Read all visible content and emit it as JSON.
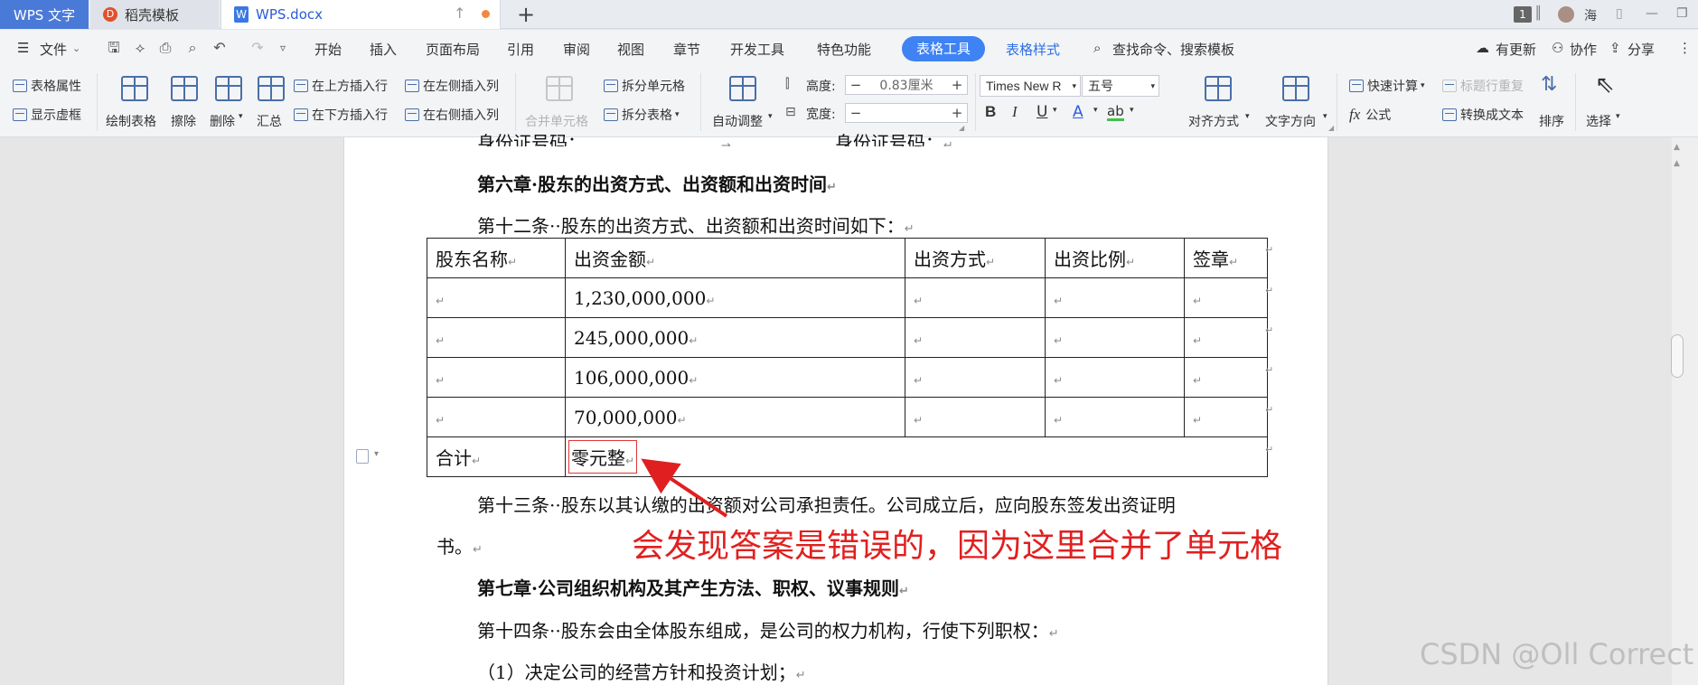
{
  "tabs": {
    "wps": "WPS 文字",
    "daoke": "稻壳模板",
    "doc": "WPS.docx",
    "doc_icon": "W",
    "daoke_icon": "D",
    "page_badge": "1",
    "user": "海"
  },
  "menu": {
    "file": "文件",
    "items": [
      "开始",
      "插入",
      "页面布局",
      "引用",
      "审阅",
      "视图",
      "章节",
      "开发工具",
      "特色功能"
    ],
    "active_tab": "表格工具",
    "table_style": "表格样式",
    "search": "查找命令、搜索模板",
    "update": "有更新",
    "collab": "协作",
    "share": "分享"
  },
  "ribbon": {
    "table_props": "表格属性",
    "show_grid": "显示虚框",
    "draw_table": "绘制表格",
    "erase": "擦除",
    "delete": "删除",
    "summary": "汇总",
    "insert_above": "在上方插入行",
    "insert_below": "在下方插入行",
    "insert_left": "在左侧插入列",
    "insert_right": "在右侧插入列",
    "merge_cells": "合并单元格",
    "split_cells": "拆分单元格",
    "split_table": "拆分表格",
    "auto_fit": "自动调整",
    "height_label": "高度:",
    "height_value": "0.83厘米",
    "width_label": "宽度:",
    "width_value": "",
    "font_name": "Times New R",
    "font_size": "五号",
    "bold": "B",
    "italic": "I",
    "underline": "U",
    "font_color": "A",
    "highlight": "ab",
    "align": "对齐方式",
    "text_direction": "文字方向",
    "quick_calc": "快速计算",
    "repeat_header": "标题行重复",
    "formula": "公式",
    "formula_icon": "fx",
    "to_text": "转换成文本",
    "sort": "排序",
    "select": "选择"
  },
  "doc": {
    "top_cut_left": "身份证号码：",
    "top_cut_right": "身份证号码：",
    "ch6": "第六章·股东的出资方式、出资额和出资时间",
    "art12": "第十二条··股东的出资方式、出资额和出资时间如下：",
    "table": {
      "headers": [
        "股东名称",
        "出资金额",
        "出资方式",
        "出资比例",
        "签章"
      ],
      "amounts": [
        "1,230,000,000",
        "245,000,000",
        "106,000,000",
        "70,000,000"
      ],
      "total_label": "合计",
      "total_value": "零元整"
    },
    "art13_line1": "第十三条··股东以其认缴的出资额对公司承担责任。公司成立后，应向股东签发出资证明",
    "art13_line2": "书。",
    "ch7": "第七章·公司组织机构及其产生方法、职权、议事规则",
    "art14": "第十四条··股东会由全体股东组成，是公司的权力机构，行使下列职权：",
    "item1": "（1）决定公司的经营方针和投资计划；"
  },
  "annotation": "会发现答案是错误的，因为这里合并了单元格",
  "watermark": "CSDN @Oll Correct",
  "colors": {
    "accent": "#3f82f4",
    "annotation": "#e02020"
  }
}
